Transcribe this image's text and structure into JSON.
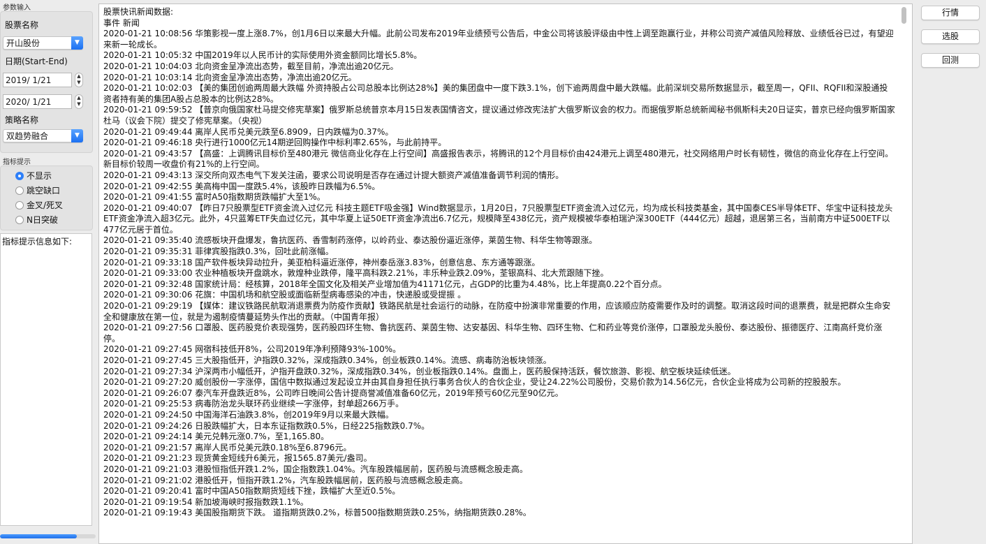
{
  "params": {
    "group_title": "参数输入",
    "stock_label": "股票名称",
    "stock_value": "开山股份",
    "date_label": "日期(Start-End)",
    "start_date": "2019/  1/21",
    "end_date": "2020/  1/21",
    "strategy_label": "策略名称",
    "strategy_value": "双趋势融合"
  },
  "indicator": {
    "group_title": "指标提示",
    "options": [
      "不显示",
      "跳空缺口",
      "金叉/死叉",
      "N日突破"
    ],
    "selected": 0,
    "info_label": "指标提示信息如下:"
  },
  "progress": {
    "value": 0.8
  },
  "buttons": {
    "quotes": "行情",
    "select": "选股",
    "backtest": "回测"
  },
  "news": {
    "header1": "股票快讯新闻数据:",
    "header2": "事件  新闻",
    "lines": [
      "2020-01-21 10:08:56  华策影视一度上涨8.7%，创1月6日以来最大升幅。此前公司发布2019年业绩预亏公告后，中金公司将该股评级由中性上调至跑赢行业，并称公司资产减值风险释放、业绩低谷已过，有望迎来新一轮成长。",
      "2020-01-21 10:05:32  中国2019年以人民币计的实际使用外资金额同比增长5.8%。",
      "2020-01-21 10:04:03  北向资金呈净流出态势，截至目前，净流出逾20亿元。",
      "2020-01-21 10:03:14  北向资金呈净流出态势，净流出逾20亿元。",
      "2020-01-21 10:02:03  【美的集团创逾两周最大跌幅 外资持股占公司总股本比例达28%】美的集团盘中一度下跌3.1%，创下逾两周盘中最大跌幅。此前深圳交易所数据显示，截至周一，QFII、RQFII和深股通投资者持有美的集团A股占总股本的比例达28%。",
      "2020-01-21 09:59:52  【普京向俄国家杜马提交修宪草案】俄罗斯总统普京本月15日发表国情咨文，提议通过修改宪法扩大俄罗斯议会的权力。而据俄罗斯总统新闻秘书佩斯科夫20日证实，普京已经向俄罗斯国家杜马（议会下院）提交了修宪草案。（央视）",
      "2020-01-21 09:49:44    离岸人民币兑美元跌至6.8909，日内跌幅为0.37%。",
      "2020-01-21 09:46:18  央行进行1000亿元14期逆回购操作中标利率2.65%，与此前持平。",
      "2020-01-21 09:43:57  【高盛：上调腾讯目标价至480港元 微信商业化存在上行空间】高盛报告表示，将腾讯的12个月目标价由424港元上调至480港元，社交网络用户时长有韧性，微信的商业化存在上行空间。新目标价较周一收盘价有21%的上行空间。",
      "2020-01-21 09:43:13    深交所向双杰电气下发关注函，要求公司说明是否存在通过计提大额资产减值准备调节利润的情形。",
      "2020-01-21 09:42:55  美高梅中国一度跌5.4%，该股昨日跌幅为6.5%。",
      "2020-01-21 09:41:55  富时A50指数期货跌幅扩大至1%。",
      "2020-01-21 09:40:07  【昨日7只股票型ETF资金流入过亿元 科技主题ETF吸金强】Wind数据显示，1月20日，7只股票型ETF资金流入过亿元，均为成长科技类基金，其中国泰CES半导体ETF、华宝中证科技龙头ETF资金净流入超3亿元。此外，4只蓝筹ETF失血过亿元，其中华夏上证50ETF资金净流出6.7亿元，规模降至438亿元，资产规模被华泰柏瑞沪深300ETF（444亿元）超越，退居第三名，当前南方中证500ETF以477亿元居于首位。",
      "2020-01-21 09:35:40  流感板块开盘爆发，鲁抗医药、香雪制药涨停，以岭药业、泰达股份逼近涨停，莱茵生物、科华生物等跟涨。",
      "2020-01-21 09:35:31  菲律宾股指跌0.3%，回吐此前涨幅。",
      "2020-01-21 09:33:18    国产软件板块异动拉升，美亚柏科逼近涨停，神州泰岳涨3.83%，创意信息、东方通等跟涨。",
      "2020-01-21 09:33:00    农业种植板块开盘跳水，敦煌种业跌停，隆平高科跌2.21%，丰乐种业跌2.09%，荃银高科、北大荒跟随下挫。",
      "2020-01-21 09:32:48  国家统计局：经核算，2018年全国文化及相关产业增加值为41171亿元，占GDP的比重为4.48%，比上年提高0.22个百分点。",
      "2020-01-21 09:30:06    花旗：中国机场和航空股或面临新型病毒感染的冲击，快递股或受提振 。",
      "2020-01-21 09:29:19    【媒体：建议铁路民航取消退票费为防疫作贡献】铁路民航是社会运行的动脉，在防疫中扮演非常重要的作用，应该顺应防疫需要作及时的调整。取消这段时间的退票费，就是把群众生命安全和健康放在第一位，就是为遏制疫情蔓延势头作出的贡献。（中国青年报）",
      "2020-01-21 09:27:56    口罩股、医药股竞价表现强势，医药股四环生物、鲁抗医药、莱茵生物、达安基因、科华生物、四环生物、仁和药业等竞价涨停，口罩股龙头股份、泰达股份、振德医疗、江南高纤竞价涨停。",
      "2020-01-21 09:27:45    网宿科技低开8%，公司2019年净利预降93%-100%。",
      "2020-01-21 09:27:45  三大股指低开，沪指跌0.32%，深成指跌0.34%，创业板跌0.14%。流感、病毒防治板块领涨。",
      "2020-01-21 09:27:34    沪深两市小幅低开，沪指开盘跌0.32%，深成指跌0.34%，创业板指跌0.14%。盘面上，医药股保持活跃，餐饮旅游、影视、航空板块延续低迷。",
      "2020-01-21 09:27:20    威创股份一字涨停，国信中数拟通过发起设立并由其自身担任执行事务合伙人的合伙企业，受让24.22%公司股份，交易价款为14.56亿元，合伙企业将成为公司新的控股股东。",
      "2020-01-21 09:26:07  泰汽车开盘跌近8%，公司昨日晚间公告计提商誉减值准备60亿元，2019年预亏60亿元至90亿元。",
      "2020-01-21 09:25:53    病毒防治龙头联环药业继续一字涨停，封单超266万手。",
      "2020-01-21 09:24:50  中国海洋石油跌3.8%，创2019年9月以来最大跌幅。",
      "2020-01-21 09:24:26  日股跌幅扩大，日本东证指数跌0.5%，日经225指数跌0.7%。",
      "2020-01-21 09:24:14  美元兑韩元涨0.7%，至1,165.80。",
      "2020-01-21 09:21:57  离岸人民币兑美元跌0.18%至6.8796元。",
      "2020-01-21 09:21:23    现货黄金短线升6美元，报1565.87美元/盎司。",
      "2020-01-21 09:21:03  港股恒指低开跌1.2%，国企指数跌1.04%。汽车股跌幅居前，医药股与流感概念股走高。",
      "2020-01-21 09:21:02    港股低开，恒指开跌1.2%，汽车股跌幅居前，医药股与流感概念股走高。",
      "2020-01-21 09:20:41  富时中国A50指数期货短线下挫，跌幅扩大至近0.5%。",
      "2020-01-21 09:19:54  新加坡海峡时报指数跌1.1%。",
      "2020-01-21 09:19:43  美国股指期货下跌。 道指期货跌0.2%，标普500指数期货跌0.25%，纳指期货跌0.28%。"
    ]
  }
}
